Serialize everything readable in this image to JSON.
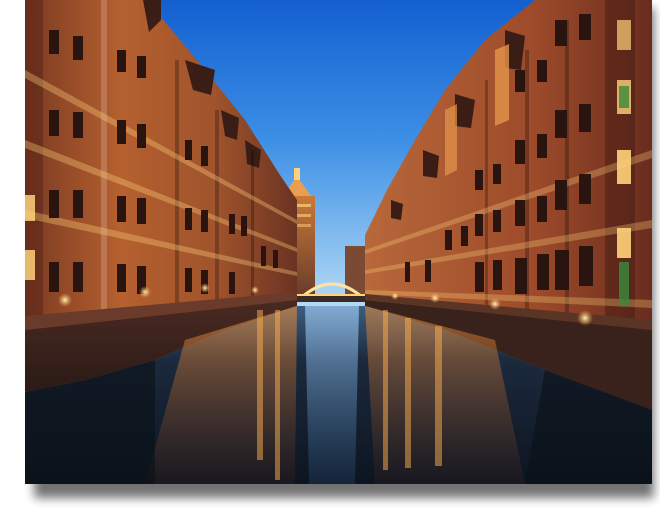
{
  "image": {
    "subject": "",
    "alt": ""
  },
  "palette": {
    "sky_top": "#1f6fd8",
    "sky_horizon": "#8cc4ef",
    "brick_dark": "#5a2418",
    "brick_lit": "#c9743c",
    "window_glow": "#ffd27a",
    "water_deep": "#0f1b2c",
    "frame": "#ffffff"
  }
}
